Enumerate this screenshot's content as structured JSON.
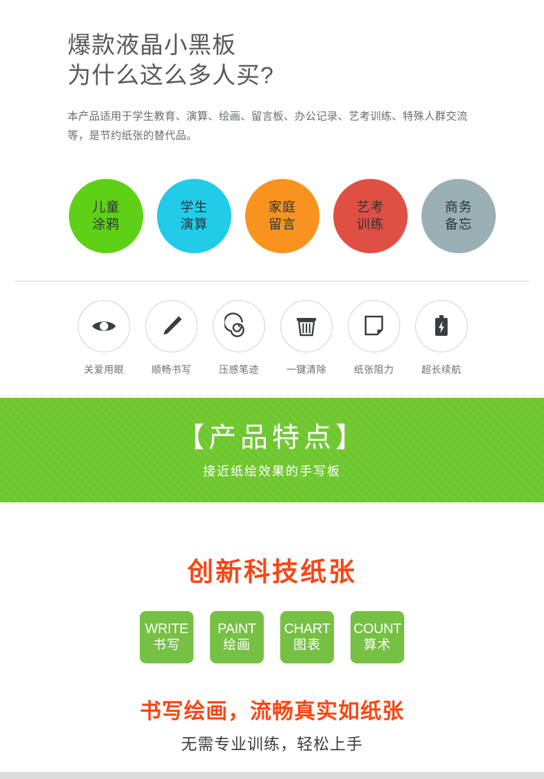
{
  "hero": {
    "title": "爆款液晶小黑板\n为什么这么多人买?",
    "subtitle": "本产品适用于学生教育、演算、绘画、留言板、办公记录、艺考训练、特殊人群交流等，是节约纸张的替代品。"
  },
  "use_cases": [
    {
      "line1": "儿童",
      "line2": "涂鸦",
      "color": "#5ed116"
    },
    {
      "line1": "学生",
      "line2": "演算",
      "color": "#22cce8"
    },
    {
      "line1": "家庭",
      "line2": "留言",
      "color": "#f8931f"
    },
    {
      "line1": "艺考",
      "line2": "训练",
      "color": "#e04f44"
    },
    {
      "line1": "商务",
      "line2": "备忘",
      "color": "#9bb0b5"
    }
  ],
  "features": [
    {
      "icon": "eye-icon",
      "label": "关爱用眼"
    },
    {
      "icon": "pencil-icon",
      "label": "顺畅书写"
    },
    {
      "icon": "spiral-icon",
      "label": "压感笔迹"
    },
    {
      "icon": "trash-icon",
      "label": "一键清除"
    },
    {
      "icon": "paper-icon",
      "label": "纸张阻力"
    },
    {
      "icon": "battery-icon",
      "label": "超长续航"
    }
  ],
  "banner": {
    "title": "【产品特点】",
    "subtitle": "接近纸绘效果的手写板",
    "background_color": "#6ec72f"
  },
  "paper_section": {
    "heading": "创新科技纸张",
    "heading_color": "#fa4614",
    "tags": [
      {
        "en": "WRITE",
        "cn": "书写"
      },
      {
        "en": "PAINT",
        "cn": "绘画"
      },
      {
        "en": "CHART",
        "cn": "图表"
      },
      {
        "en": "COUNT",
        "cn": "算术"
      }
    ],
    "tag_color": "#76c043",
    "closing_primary": "书写绘画，流畅真实如纸张",
    "closing_secondary": "无需专业训练，轻松上手"
  }
}
